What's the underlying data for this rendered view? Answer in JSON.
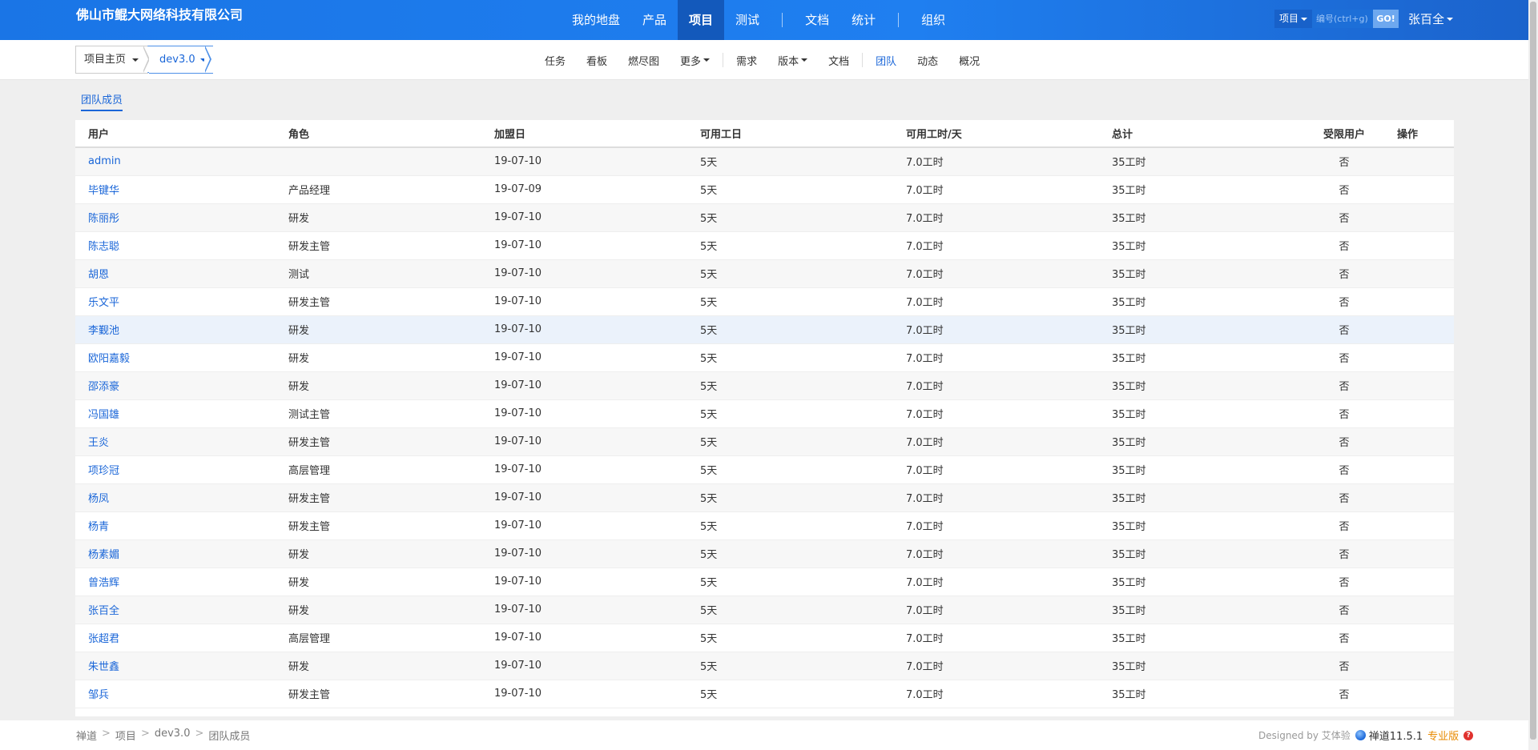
{
  "header": {
    "company": "佛山市鲲大网络科技有限公司",
    "nav": [
      {
        "label": "我的地盘",
        "active": false
      },
      {
        "label": "产品",
        "active": false
      },
      {
        "label": "项目",
        "active": true
      },
      {
        "label": "测试",
        "active": false
      },
      {
        "label": "文档",
        "active": false
      },
      {
        "label": "统计",
        "active": false
      },
      {
        "label": "组织",
        "active": false
      }
    ],
    "search": {
      "type": "项目",
      "placeholder": "编号(ctrl+g)",
      "go": "GO!"
    },
    "user": "张百全",
    "colors": {
      "primary": "#1a75e6",
      "active_tab": "#1359bb"
    }
  },
  "subnav": {
    "crumb_project": "项目主页",
    "crumb_version": "dev3.0",
    "items": [
      {
        "label": "任务",
        "dropdown": false,
        "active": false
      },
      {
        "label": "看板",
        "dropdown": false,
        "active": false
      },
      {
        "label": "燃尽图",
        "dropdown": false,
        "active": false
      },
      {
        "label": "更多",
        "dropdown": true,
        "active": false
      },
      {
        "label": "需求",
        "dropdown": false,
        "active": false
      },
      {
        "label": "版本",
        "dropdown": true,
        "active": false
      },
      {
        "label": "文档",
        "dropdown": false,
        "active": false
      },
      {
        "label": "团队",
        "dropdown": false,
        "active": true
      },
      {
        "label": "动态",
        "dropdown": false,
        "active": false
      },
      {
        "label": "概况",
        "dropdown": false,
        "active": false
      }
    ]
  },
  "main": {
    "tab": "团队成员",
    "columns": [
      "用户",
      "角色",
      "加盟日",
      "可用工日",
      "可用工时/天",
      "总计",
      "受限用户",
      "操作"
    ],
    "rows": [
      {
        "user": "admin",
        "role": "",
        "joined": "19-07-10",
        "days": "5天",
        "hours": "7.0工时",
        "total": "35工时",
        "limited": "否"
      },
      {
        "user": "毕键华",
        "role": "产品经理",
        "joined": "19-07-09",
        "days": "5天",
        "hours": "7.0工时",
        "total": "35工时",
        "limited": "否"
      },
      {
        "user": "陈丽彤",
        "role": "研发",
        "joined": "19-07-10",
        "days": "5天",
        "hours": "7.0工时",
        "total": "35工时",
        "limited": "否"
      },
      {
        "user": "陈志聪",
        "role": "研发主管",
        "joined": "19-07-10",
        "days": "5天",
        "hours": "7.0工时",
        "total": "35工时",
        "limited": "否"
      },
      {
        "user": "胡恩",
        "role": "测试",
        "joined": "19-07-10",
        "days": "5天",
        "hours": "7.0工时",
        "total": "35工时",
        "limited": "否"
      },
      {
        "user": "乐文平",
        "role": "研发主管",
        "joined": "19-07-10",
        "days": "5天",
        "hours": "7.0工时",
        "total": "35工时",
        "limited": "否"
      },
      {
        "user": "李觐池",
        "role": "研发",
        "joined": "19-07-10",
        "days": "5天",
        "hours": "7.0工时",
        "total": "35工时",
        "limited": "否"
      },
      {
        "user": "欧阳嘉毅",
        "role": "研发",
        "joined": "19-07-10",
        "days": "5天",
        "hours": "7.0工时",
        "total": "35工时",
        "limited": "否"
      },
      {
        "user": "邵添豪",
        "role": "研发",
        "joined": "19-07-10",
        "days": "5天",
        "hours": "7.0工时",
        "total": "35工时",
        "limited": "否"
      },
      {
        "user": "冯国雄",
        "role": "测试主管",
        "joined": "19-07-10",
        "days": "5天",
        "hours": "7.0工时",
        "total": "35工时",
        "limited": "否"
      },
      {
        "user": "王炎",
        "role": "研发主管",
        "joined": "19-07-10",
        "days": "5天",
        "hours": "7.0工时",
        "total": "35工时",
        "limited": "否"
      },
      {
        "user": "项珍冠",
        "role": "高层管理",
        "joined": "19-07-10",
        "days": "5天",
        "hours": "7.0工时",
        "total": "35工时",
        "limited": "否"
      },
      {
        "user": "杨凤",
        "role": "研发主管",
        "joined": "19-07-10",
        "days": "5天",
        "hours": "7.0工时",
        "total": "35工时",
        "limited": "否"
      },
      {
        "user": "杨青",
        "role": "研发主管",
        "joined": "19-07-10",
        "days": "5天",
        "hours": "7.0工时",
        "total": "35工时",
        "limited": "否"
      },
      {
        "user": "杨素媚",
        "role": "研发",
        "joined": "19-07-10",
        "days": "5天",
        "hours": "7.0工时",
        "total": "35工时",
        "limited": "否"
      },
      {
        "user": "曾浩辉",
        "role": "研发",
        "joined": "19-07-10",
        "days": "5天",
        "hours": "7.0工时",
        "total": "35工时",
        "limited": "否"
      },
      {
        "user": "张百全",
        "role": "研发",
        "joined": "19-07-10",
        "days": "5天",
        "hours": "7.0工时",
        "total": "35工时",
        "limited": "否"
      },
      {
        "user": "张超君",
        "role": "高层管理",
        "joined": "19-07-10",
        "days": "5天",
        "hours": "7.0工时",
        "total": "35工时",
        "limited": "否"
      },
      {
        "user": "朱世鑫",
        "role": "研发",
        "joined": "19-07-10",
        "days": "5天",
        "hours": "7.0工时",
        "total": "35工时",
        "limited": "否"
      },
      {
        "user": "邹兵",
        "role": "研发主管",
        "joined": "19-07-10",
        "days": "5天",
        "hours": "7.0工时",
        "total": "35工时",
        "limited": "否"
      }
    ]
  },
  "footer": {
    "crumbs": [
      "禅道",
      "项目",
      "dev3.0",
      "团队成员"
    ],
    "separator": ">",
    "designed_by": "Designed by 艾体验",
    "version": "禅道11.5.1",
    "edition": "专业版",
    "help_icon": "?"
  }
}
